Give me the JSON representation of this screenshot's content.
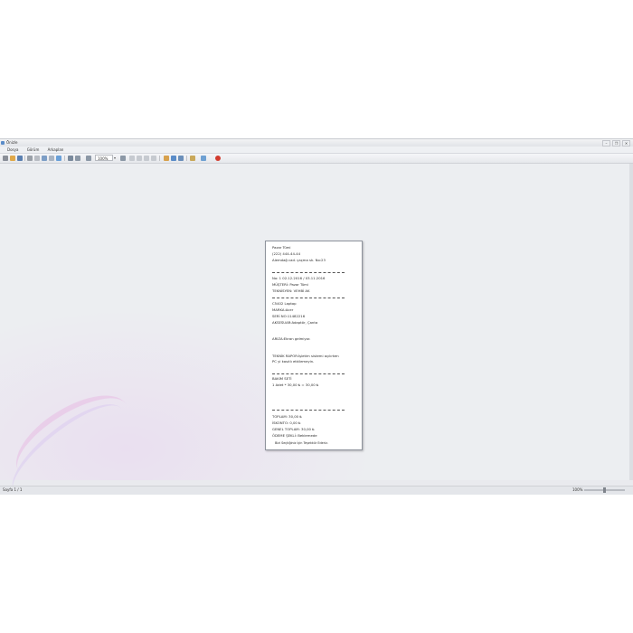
{
  "window": {
    "title": "Önizle",
    "controls": [
      "–",
      "❐",
      "✕"
    ]
  },
  "menu": [
    "Dosya",
    "Görüm",
    "Arkaplan"
  ],
  "toolbar": {
    "zoom_value": "100%"
  },
  "receipt": {
    "shop_name": "Pazar Tümi",
    "phone": "(222) 444-44-44",
    "address": "Alemdağ cad. çaçma sk. No:23",
    "no_line": "No:  1                    02.12.2016  /  03.11.2016",
    "customer": "MÜŞTERİ: Pazar Tümi",
    "technician": "TEKNİSYEN: VEHBİ AK",
    "device": "C5402 Laptop",
    "brand": "MARKA:Acer",
    "serial": "SERİ NO:11482216",
    "accessories": "AKSESUAR:Adaptör, Çanta",
    "fault": "ARIZA:Ekran gelmiyor.",
    "tech_report_1": "TEKNİK RAPOR:İşletim sistemi açılırken",
    "tech_report_2": "PC yi kasıtlı etkilemeyin.",
    "maintenance_title": "BAKIM SETİ",
    "maintenance_line": "1 Adet * 30,00 ₺ = 30,00 ₺",
    "total": "TOPLAM:              30,00 ₺",
    "discount": "İSKONTO:                0,00 ₺",
    "grand_total": "GENEL TOPLAM:        30,00 ₺",
    "payment": "ÖDEME ŞEKLİ: Beklemede",
    "thanks": "Bizi Seçtiğiniz İçin Teşekkür Ederiz."
  },
  "status": {
    "page_info": "Sayfa 1 / 1",
    "zoom_level": "100%"
  },
  "colors": {
    "accent": "#5a8cc8",
    "background": "#eceef1"
  }
}
